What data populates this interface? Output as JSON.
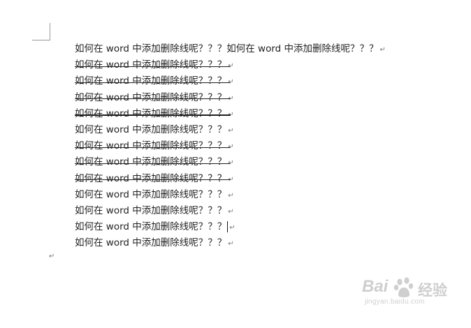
{
  "document": {
    "lines": [
      {
        "text": "如何在 word 中添加删除线呢？？？如何在 word 中添加删除线呢？？？",
        "strikethrough": false
      },
      {
        "text": "如何在 word 中添加删除线呢？？？",
        "strikethrough": true
      },
      {
        "text": "如何在 word 中添加删除线呢？？？",
        "strikethrough": true
      },
      {
        "text": "如何在 word 中添加删除线呢？？？",
        "strikethrough": true
      },
      {
        "text": "如何在 word 中添加删除线呢？？？",
        "strikethrough": true
      },
      {
        "text": "如何在 word 中添加删除线呢？？？",
        "strikethrough": false
      },
      {
        "text": "如何在 word 中添加删除线呢？？？",
        "strikethrough": true
      },
      {
        "text": "如何在 word 中添加删除线呢？？？",
        "strikethrough": true
      },
      {
        "text": "如何在 word 中添加删除线呢？？？",
        "strikethrough": true
      },
      {
        "text": "如何在 word 中添加删除线呢？？？",
        "strikethrough": false
      },
      {
        "text": "如何在 word 中添加删除线呢？？？",
        "strikethrough": false
      },
      {
        "text": "如何在 word 中添加删除线呢？？？",
        "strikethrough": false,
        "caret": true
      },
      {
        "text": "如何在 word 中添加删除线呢？？？",
        "strikethrough": false
      }
    ],
    "paragraph_mark": "↵"
  },
  "watermark": {
    "brand": "Bai",
    "brand_cn": "经验",
    "url": "jingyan.baidu.com"
  }
}
